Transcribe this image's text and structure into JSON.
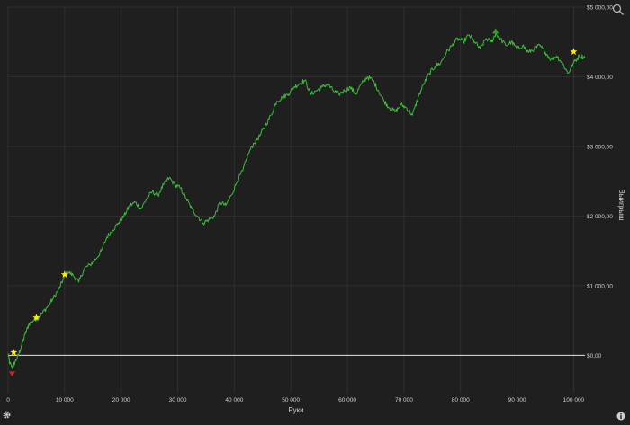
{
  "colors": {
    "background": "#1f1f1f",
    "plot_background": "#1f1f1f",
    "grid": "#2f2f2f",
    "axis_text": "#cfcfcf",
    "series_line": "#3fb93f",
    "zero_line": "#e6e6e6",
    "star_marker": "#ffee00",
    "max_marker": "#2fa52f",
    "min_marker": "#d42020"
  },
  "icons": {
    "zoom": "magnifier-icon",
    "settings": "gear-icon",
    "info": "info-icon"
  },
  "chart_data": {
    "type": "line",
    "xlabel": "Руки",
    "ylabel": "Выигрыш",
    "xlim": [
      0,
      102000
    ],
    "ylim": [
      -550,
      5000
    ],
    "x_ticks": [
      0,
      10000,
      20000,
      30000,
      40000,
      50000,
      60000,
      70000,
      80000,
      90000,
      100000
    ],
    "x_tick_labels": [
      "0",
      "10 000",
      "20 000",
      "30 000",
      "40 000",
      "50 000",
      "60 000",
      "70 000",
      "80 000",
      "90 000",
      "100 000"
    ],
    "y_ticks": [
      0,
      1000,
      2000,
      3000,
      4000,
      5000
    ],
    "y_tick_labels": [
      "$0,00",
      "$1 000,00",
      "$2 000,00",
      "$3 000,00",
      "$4 000,00",
      "$5 000,00"
    ],
    "grid": true,
    "series": [
      {
        "x": [
          0,
          300,
          800,
          1200,
          1800,
          2300,
          3000,
          3700,
          4500,
          5300,
          6000,
          7000,
          8000,
          9000,
          9800,
          10500,
          11500,
          12500,
          13500,
          14500,
          15500,
          16500,
          17500,
          18500,
          19500,
          20500,
          21500,
          22500,
          23500,
          24500,
          25500,
          26500,
          27500,
          28500,
          29500,
          30500,
          31500,
          32500,
          33500,
          34500,
          35500,
          36500,
          37500,
          38500,
          39500,
          40500,
          41500,
          42500,
          43500,
          44500,
          45500,
          46500,
          47500,
          48500,
          49500,
          50500,
          51500,
          52500,
          53500,
          54500,
          55500,
          56500,
          57500,
          58500,
          59500,
          60500,
          61500,
          62500,
          63500,
          64500,
          65500,
          66500,
          67500,
          68500,
          69500,
          70500,
          71500,
          72500,
          73500,
          74500,
          75500,
          76500,
          77500,
          78500,
          79500,
          80500,
          81500,
          82500,
          83500,
          84500,
          85500,
          86200,
          87000,
          88000,
          89000,
          90000,
          91000,
          92000,
          93000,
          94000,
          95000,
          96000,
          97000,
          98000,
          99000,
          100000,
          101000,
          102000
        ],
        "y": [
          30,
          -120,
          -180,
          -100,
          0,
          120,
          300,
          450,
          500,
          550,
          600,
          700,
          820,
          950,
          1100,
          1200,
          1150,
          1050,
          1250,
          1300,
          1380,
          1500,
          1700,
          1800,
          1900,
          2000,
          2150,
          2200,
          2100,
          2250,
          2350,
          2300,
          2450,
          2550,
          2450,
          2400,
          2250,
          2100,
          2000,
          1900,
          1950,
          2000,
          2200,
          2150,
          2300,
          2500,
          2650,
          2900,
          3050,
          3150,
          3300,
          3450,
          3650,
          3700,
          3750,
          3850,
          3900,
          3950,
          3750,
          3800,
          3850,
          3900,
          3800,
          3750,
          3800,
          3850,
          3750,
          3900,
          4000,
          3950,
          3800,
          3650,
          3550,
          3500,
          3600,
          3550,
          3450,
          3700,
          3900,
          4050,
          4150,
          4200,
          4350,
          4450,
          4550,
          4500,
          4600,
          4500,
          4400,
          4550,
          4500,
          4620,
          4550,
          4450,
          4500,
          4400,
          4450,
          4350,
          4400,
          4450,
          4350,
          4250,
          4300,
          4200,
          4050,
          4200,
          4300,
          4280
        ]
      }
    ],
    "markers": [
      {
        "type": "star",
        "x": 1000,
        "y": 40
      },
      {
        "type": "star",
        "x": 5000,
        "y": 540
      },
      {
        "type": "star",
        "x": 10000,
        "y": 1160
      },
      {
        "type": "star",
        "x": 100000,
        "y": 4360
      },
      {
        "type": "max",
        "x": 86200,
        "y": 4660
      },
      {
        "type": "min",
        "x": 700,
        "y": -270
      }
    ]
  }
}
